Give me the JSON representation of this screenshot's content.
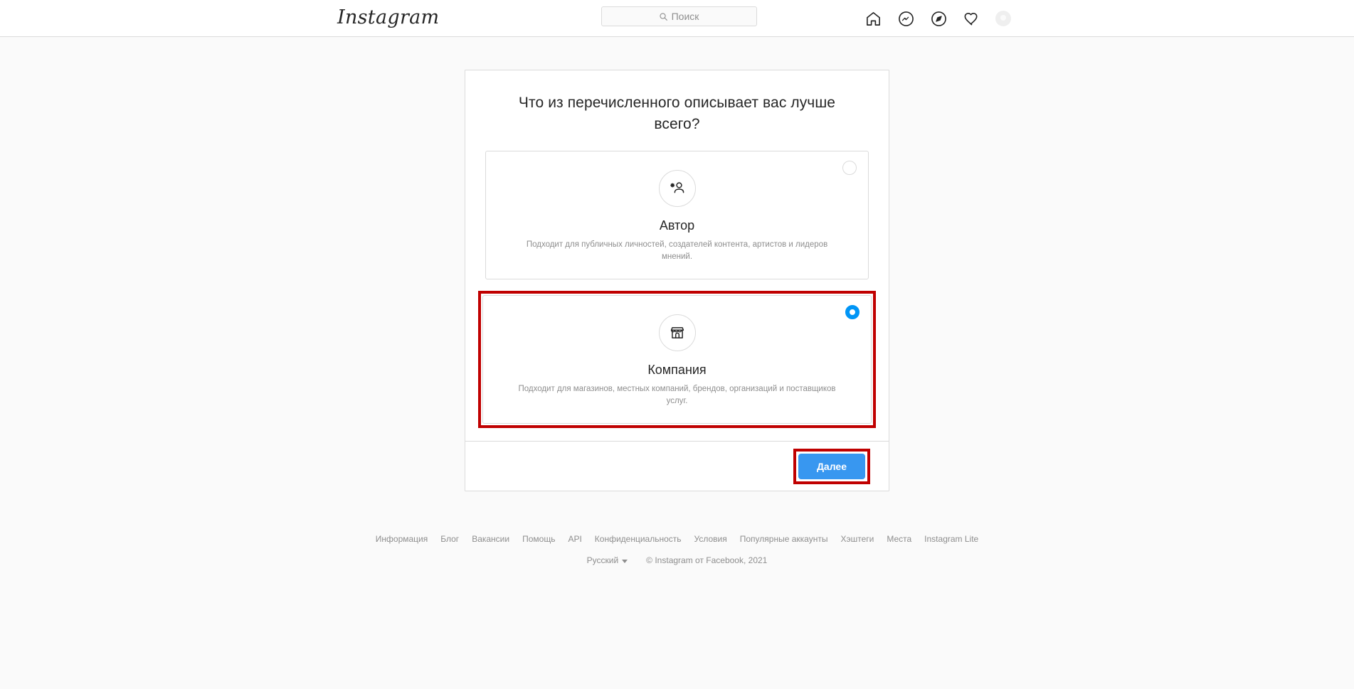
{
  "header": {
    "logo_text": "Instagram",
    "search": {
      "icon": "search-icon",
      "placeholder": "Поиск",
      "value": ""
    },
    "nav": [
      {
        "name": "home-icon",
        "label": "Главная"
      },
      {
        "name": "messenger-icon",
        "label": "Сообщения"
      },
      {
        "name": "compass-icon",
        "label": "Интересное"
      },
      {
        "name": "heart-icon",
        "label": "Уведомления"
      },
      {
        "name": "avatar",
        "label": "Профиль"
      }
    ]
  },
  "card": {
    "heading": "Что из перечисленного описывает вас лучше всего?",
    "options": [
      {
        "id": "creator",
        "icon": "creator-person-star-icon",
        "title": "Автор",
        "description": "Подходит для публичных личностей, создателей контента, артистов и лидеров мнений.",
        "selected": false,
        "annotated": false
      },
      {
        "id": "business",
        "icon": "storefront-icon",
        "title": "Компания",
        "description": "Подходит для магазинов, местных компаний, брендов, организаций и поставщиков услуг.",
        "selected": true,
        "annotated": true
      }
    ],
    "next_button": "Далее"
  },
  "footer": {
    "links": [
      "Информация",
      "Блог",
      "Вакансии",
      "Помощь",
      "API",
      "Конфиденциальность",
      "Условия",
      "Популярные аккаунты",
      "Хэштеги",
      "Места",
      "Instagram Lite"
    ],
    "language": "Русский",
    "copyright": "© Instagram от Facebook, 2021"
  },
  "colors": {
    "accent_blue": "#3897f0",
    "radio_blue": "#0095f6",
    "annotation_red": "#c00000",
    "page_bg": "#fafafa",
    "border": "#dbdbdb",
    "muted_text": "#8e8e8e",
    "text": "#262626"
  }
}
